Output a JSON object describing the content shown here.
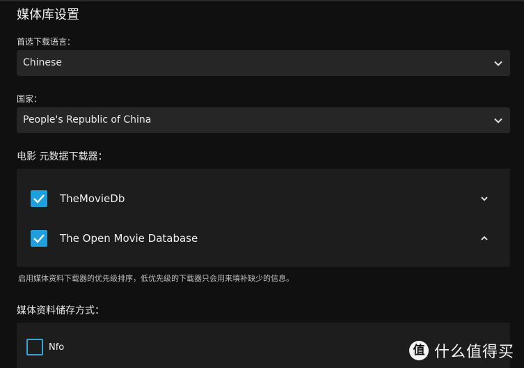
{
  "section_title": "媒体库设置",
  "language": {
    "label": "首选下载语言：",
    "selected": "Chinese",
    "icon": "chevron-down-icon"
  },
  "country": {
    "label": "国家：",
    "selected": "People's Republic of China",
    "icon": "chevron-down-icon"
  },
  "movie_downloaders": {
    "label": "电影 元数据下载器：",
    "items": [
      {
        "label": "TheMovieDb",
        "checked": true,
        "toggle_icon": "chevron-down-icon"
      },
      {
        "label": "The Open Movie Database",
        "checked": true,
        "toggle_icon": "chevron-up-icon"
      }
    ],
    "hint": "启用媒体资料下载器的优先级排序，低优先级的下载器只会用来填补缺少的信息。"
  },
  "metadata_savers": {
    "label": "媒体资料储存方式：",
    "items": [
      {
        "label": "Nfo",
        "checked": false
      }
    ]
  },
  "watermark": {
    "logo_char": "值",
    "text": "什么值得买"
  },
  "colors": {
    "background": "#101010",
    "panel": "#1d1d1d",
    "select": "#262626",
    "accent": "#1fa0dc"
  }
}
